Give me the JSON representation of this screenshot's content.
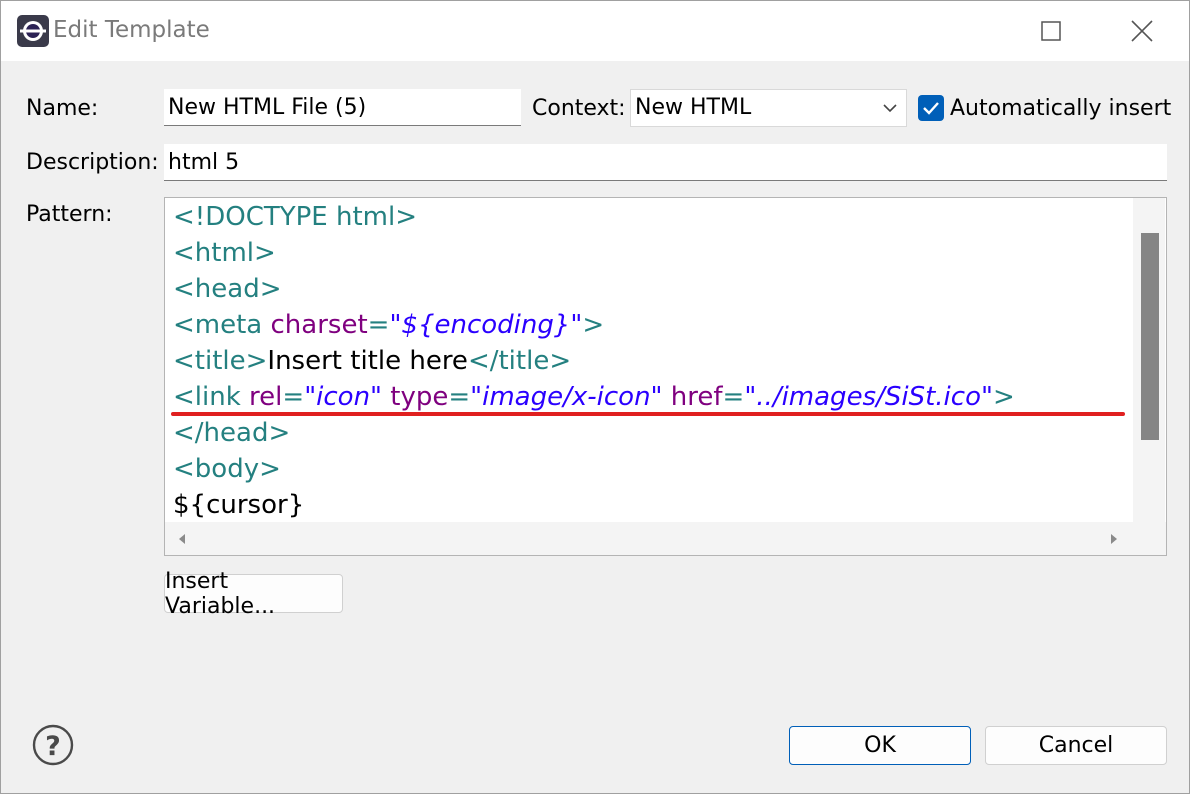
{
  "window": {
    "title": "Edit Template",
    "app_icon": "eclipse-icon",
    "maximize_icon": "maximize-icon",
    "close_icon": "close-icon"
  },
  "form": {
    "name_label": "Name:",
    "name_value": "New HTML File (5)",
    "context_label": "Context:",
    "context_value": "New HTML",
    "auto_insert_label": "Automatically insert",
    "auto_insert_checked": true,
    "description_label": "Description:",
    "description_value": "html 5",
    "pattern_label": "Pattern:"
  },
  "pattern": {
    "lines": [
      [
        {
          "t": "tag",
          "s": "<!DOCTYPE html>"
        }
      ],
      [
        {
          "t": "tag",
          "s": "<html>"
        }
      ],
      [
        {
          "t": "tag",
          "s": "<head>"
        }
      ],
      [
        {
          "t": "tag",
          "s": "<meta "
        },
        {
          "t": "attr",
          "s": "charset"
        },
        {
          "t": "tag",
          "s": "="
        },
        {
          "t": "val",
          "s": "\"${encoding}\""
        },
        {
          "t": "tag",
          "s": ">"
        }
      ],
      [
        {
          "t": "tag",
          "s": "<title>"
        },
        {
          "t": "plain",
          "s": "Insert title here"
        },
        {
          "t": "tag",
          "s": "</title>"
        }
      ],
      [
        {
          "t": "tag",
          "s": "<link "
        },
        {
          "t": "attr",
          "s": "rel"
        },
        {
          "t": "tag",
          "s": "="
        },
        {
          "t": "val",
          "s": "\"icon\""
        },
        {
          "t": "tag",
          "s": " "
        },
        {
          "t": "attr",
          "s": "type"
        },
        {
          "t": "tag",
          "s": "="
        },
        {
          "t": "val",
          "s": "\"image/x-icon\""
        },
        {
          "t": "tag",
          "s": " "
        },
        {
          "t": "attr",
          "s": "href"
        },
        {
          "t": "tag",
          "s": "="
        },
        {
          "t": "val",
          "s": "\"../images/SiSt.ico\""
        },
        {
          "t": "tag",
          "s": ">"
        }
      ],
      [
        {
          "t": "tag",
          "s": "</head>"
        }
      ],
      [
        {
          "t": "tag",
          "s": "<body>"
        }
      ],
      [
        {
          "t": "plain",
          "s": "${cursor}"
        }
      ]
    ],
    "highlighted_line": 6
  },
  "buttons": {
    "insert_variable": "Insert Variable...",
    "ok": "OK",
    "cancel": "Cancel"
  },
  "colors": {
    "tag": "#248080",
    "attr": "#7f007f",
    "value": "#2a00ff",
    "highlight_underline": "#e02020",
    "accent": "#005fb8"
  }
}
